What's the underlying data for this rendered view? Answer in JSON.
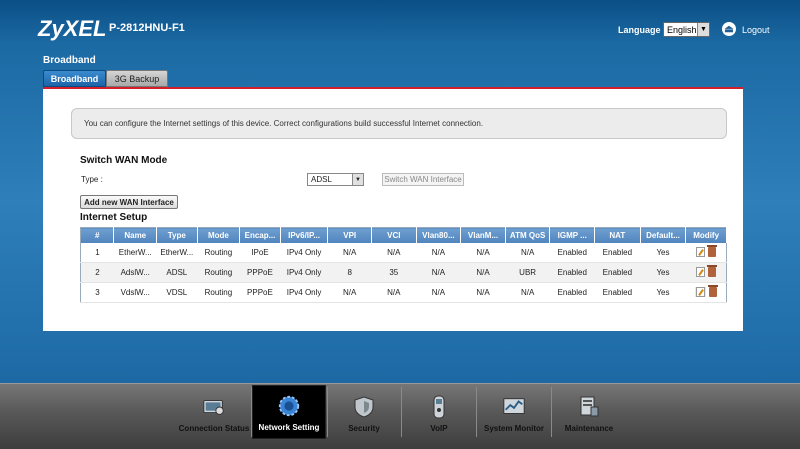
{
  "header": {
    "brand": "ZyXEL",
    "model": "P-2812HNU-F1",
    "language_label": "Language :",
    "language_value": "English",
    "logout_label": "Logout"
  },
  "page": {
    "title": "Broadband"
  },
  "tabs": [
    {
      "label": "Broadband",
      "active": true
    },
    {
      "label": "3G Backup",
      "active": false
    }
  ],
  "info_text": "You can configure the Internet settings of this device. Correct configurations build successful Internet connection.",
  "switch_wan": {
    "title": "Switch WAN Mode",
    "type_label": "Type :",
    "type_value": "ADSL",
    "switch_button": "Switch WAN Interface"
  },
  "add_button": "Add new WAN Interface",
  "internet_setup": {
    "title": "Internet Setup",
    "columns": [
      "#",
      "Name",
      "Type",
      "Mode",
      "Encap...",
      "IPv6/IP...",
      "VPI",
      "VCI",
      "Vlan80...",
      "VlanM...",
      "ATM QoS",
      "IGMP ...",
      "NAT",
      "Default...",
      "Modify"
    ],
    "rows": [
      [
        "1",
        "EtherW...",
        "EtherW...",
        "Routing",
        "IPoE",
        "IPv4 Only",
        "N/A",
        "N/A",
        "N/A",
        "N/A",
        "N/A",
        "Enabled",
        "Enabled",
        "Yes"
      ],
      [
        "2",
        "AdslW...",
        "ADSL",
        "Routing",
        "PPPoE",
        "IPv4 Only",
        "8",
        "35",
        "N/A",
        "N/A",
        "UBR",
        "Enabled",
        "Enabled",
        "Yes"
      ],
      [
        "3",
        "VdslW...",
        "VDSL",
        "Routing",
        "PPPoE",
        "IPv4 Only",
        "N/A",
        "N/A",
        "N/A",
        "N/A",
        "N/A",
        "Enabled",
        "Enabled",
        "Yes"
      ]
    ]
  },
  "bottom_nav": [
    {
      "label": "Connection Status",
      "icon": "connection-status-icon",
      "active": false
    },
    {
      "label": "Network Setting",
      "icon": "network-setting-icon",
      "active": true
    },
    {
      "label": "Security",
      "icon": "security-icon",
      "active": false
    },
    {
      "label": "VoIP",
      "icon": "voip-icon",
      "active": false
    },
    {
      "label": "System Monitor",
      "icon": "system-monitor-icon",
      "active": false
    },
    {
      "label": "Maintenance",
      "icon": "maintenance-icon",
      "active": false
    }
  ],
  "colors": {
    "accent_blue": "#2e7fba",
    "panel_top_border": "#d21f2a",
    "table_header": "#5b8fc4",
    "highlight": "#ffff40"
  }
}
